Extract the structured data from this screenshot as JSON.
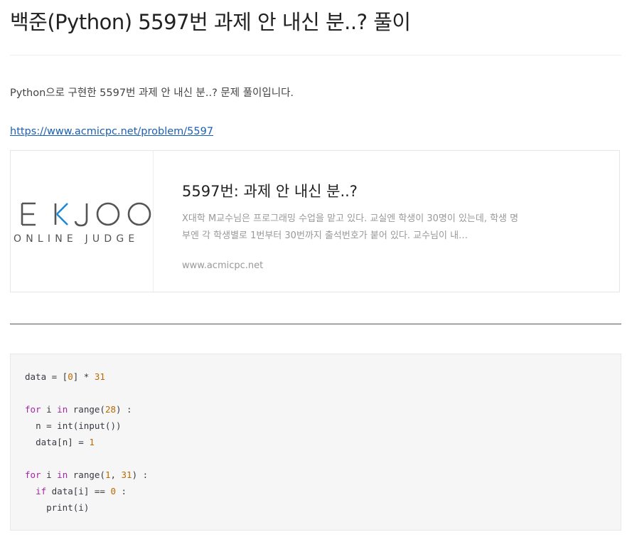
{
  "post": {
    "title": "백준(Python) 5597번 과제 안 내신 분..? 풀이",
    "intro": "Python으로 구현한 5597번 과제 안 내신 분..? 문제 풀이입니다.",
    "link_text": "https://www.acmicpc.net/problem/5597"
  },
  "og_card": {
    "logo_text": "EKJOO",
    "logo_subtext": "ONLINE JUDGE",
    "logo_accent_color": "#1f8ad2",
    "logo_color": "#555555",
    "title": "5597번: 과제 안 내신 분..?",
    "description": "X대학 M교수님은 프로그래밍 수업을 맡고 있다. 교실엔 학생이 30명이 있는데, 학생 명부엔 각 학생별로 1번부터 30번까지 출석번호가 붙어 있다. 교수님이 내…",
    "domain": "www.acmicpc.net"
  },
  "code": {
    "lines": [
      "data = [0] * 31",
      "",
      "for i in range(28) :",
      "  n = int(input())",
      "  data[n] = 1",
      "",
      "for i in range(1, 31) :",
      "  if data[i] == 0 :",
      "    print(i)"
    ]
  },
  "colors": {
    "keyword": "#a626a4",
    "number": "#b76b01",
    "link": "#1a5fb4",
    "code_background": "#f6f6f6"
  }
}
